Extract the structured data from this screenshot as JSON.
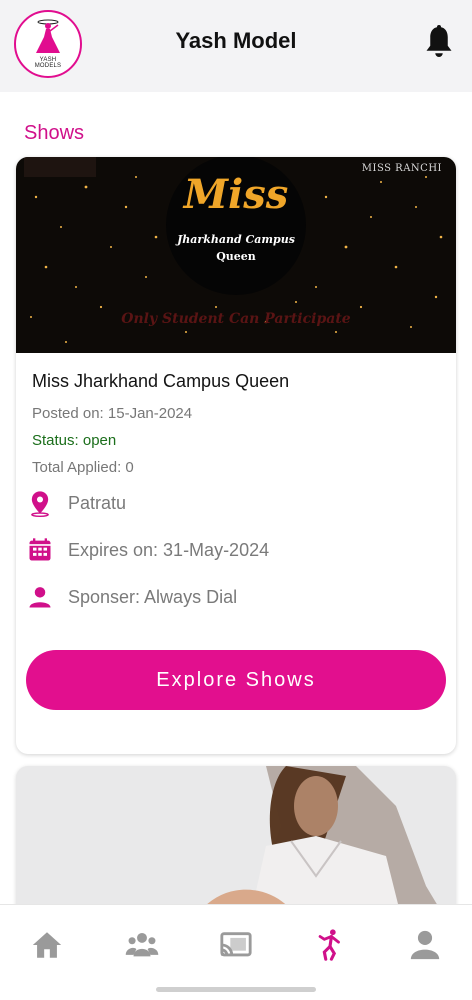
{
  "header": {
    "title": "Yash Model",
    "logo_text_line1": "YASH",
    "logo_text_line2": "MODELS",
    "notification_icon": "bell-icon"
  },
  "section": {
    "title": "Shows"
  },
  "shows": [
    {
      "banner": {
        "miss": "Miss",
        "subtitle_line1": "Jharkhand Campus",
        "subtitle_line2": "Queen",
        "tagline": "Only Student Can Participate",
        "corner_brand": "MISS RANCHI"
      },
      "name": "Miss Jharkhand Campus Queen",
      "posted": "Posted on: 15-Jan-2024",
      "status": "Status: open",
      "total_applied": "Total Applied: 0",
      "location": "Patratu",
      "expires": "Expires on: 31-May-2024",
      "sponsor": "Sponser: Always Dial",
      "button_label": "Explore Shows"
    }
  ],
  "bottom_nav": {
    "items": [
      {
        "icon": "home-icon",
        "active": false
      },
      {
        "icon": "group-icon",
        "active": false
      },
      {
        "icon": "cast-icon",
        "active": false
      },
      {
        "icon": "dance-icon",
        "active": true
      },
      {
        "icon": "profile-icon",
        "active": false
      }
    ]
  },
  "colors": {
    "accent": "#e20f8e",
    "status_open": "#1b6e1b",
    "inactive_icon": "#9a9a9a"
  }
}
